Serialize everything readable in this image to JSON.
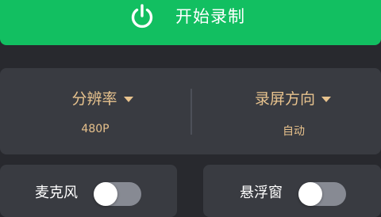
{
  "start_button": {
    "label": "开始录制",
    "icon": "power-icon",
    "color": "#12bf61"
  },
  "settings": {
    "resolution": {
      "title": "分辨率",
      "value": "480P"
    },
    "orientation": {
      "title": "录屏方向",
      "value": "自动"
    },
    "accent_color": "#e8c38e"
  },
  "toggles": {
    "microphone": {
      "label": "麦克风",
      "on": false
    },
    "floating_window": {
      "label": "悬浮窗",
      "on": false
    }
  }
}
